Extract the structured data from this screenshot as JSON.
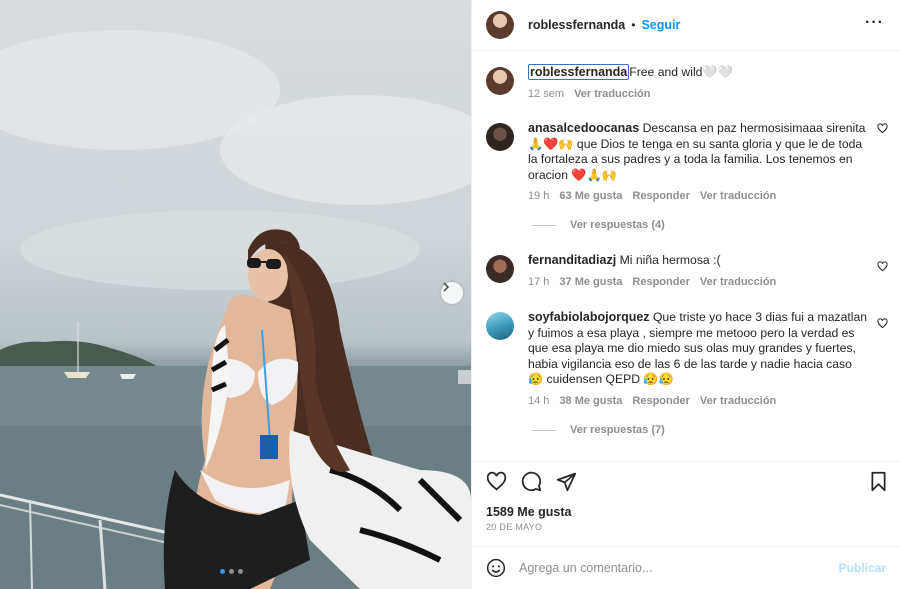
{
  "post_image": {
    "next_button_icon": "chevron-right-icon",
    "carousel_dots": 3,
    "active_dot": 1
  },
  "header": {
    "username": "roblessfernanda",
    "separator": "•",
    "follow_label": "Seguir",
    "more_icon": "more-horizontal-icon"
  },
  "caption": {
    "username": "roblessfernanda",
    "text": "Free and wild🤍🤍",
    "time": "12 sem",
    "translate": "Ver traducción"
  },
  "comments": [
    {
      "username": "anasalcedoocanas",
      "text": "Descansa en paz hermosisimaaa sirenita 🙏❤️🙌 que Dios te tenga en su santa gloria y que le de toda la fortaleza a sus padres y a toda la familia. Los tenemos en oracion ❤️🙏🙌",
      "time": "19 h",
      "likes": "63 Me gusta",
      "reply": "Responder",
      "translate": "Ver traducción",
      "replies_label": "Ver respuestas (4)"
    },
    {
      "username": "fernanditadiazj",
      "text": "Mi niña hermosa :(",
      "time": "17 h",
      "likes": "37 Me gusta",
      "reply": "Responder",
      "translate": "Ver traducción"
    },
    {
      "username": "soyfabiolabojorquez",
      "text": "Que triste yo hace 3 dias fui a mazatlan y fuimos a esa playa , siempre me metooo pero la verdad es que esa playa me dio miedo sus olas muy grandes y fuertes, habia vigilancia eso de las 6 de las tarde y nadie hacia caso 😥 cuidensen QEPD 😥😥",
      "time": "14 h",
      "likes": "38 Me gusta",
      "reply": "Responder",
      "translate": "Ver traducción",
      "replies_label": "Ver respuestas (7)"
    }
  ],
  "actions": {
    "likes": "1589 Me gusta",
    "date": "20 DE MAYO"
  },
  "add_comment": {
    "placeholder": "Agrega un comentario...",
    "publish_label": "Publicar"
  }
}
